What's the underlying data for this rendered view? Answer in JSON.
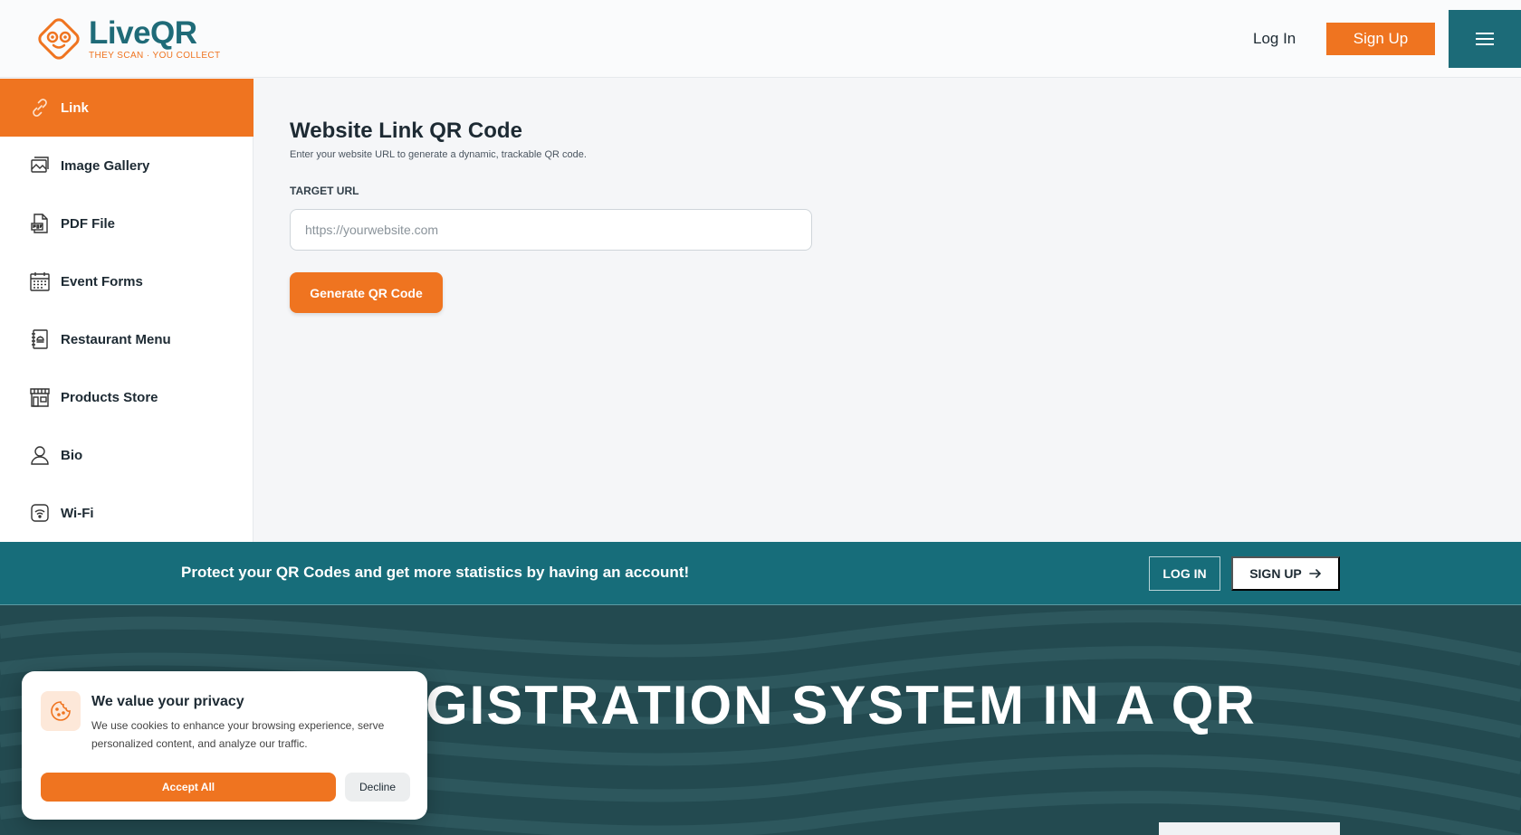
{
  "brand": {
    "name_part1": "Live",
    "name_part2": "QR",
    "tagline": "THEY SCAN · YOU COLLECT",
    "accent": "#ef7420",
    "primary": "#1c6b78"
  },
  "header": {
    "login_label": "Log In",
    "signup_label": "Sign Up",
    "menu_icon": "hamburger-icon"
  },
  "sidebar": {
    "items": [
      {
        "label": "Link",
        "icon": "link-icon",
        "active": true
      },
      {
        "label": "Image Gallery",
        "icon": "image-gallery-icon",
        "active": false
      },
      {
        "label": "PDF File",
        "icon": "pdf-file-icon",
        "active": false
      },
      {
        "label": "Event Forms",
        "icon": "calendar-icon",
        "active": false
      },
      {
        "label": "Restaurant Menu",
        "icon": "menu-book-icon",
        "active": false
      },
      {
        "label": "Products Store",
        "icon": "store-icon",
        "active": false
      },
      {
        "label": "Bio",
        "icon": "person-icon",
        "active": false
      },
      {
        "label": "Wi-Fi",
        "icon": "wifi-icon",
        "active": false
      }
    ]
  },
  "main": {
    "title": "Website Link QR Code",
    "subtitle": "Enter your website URL to generate a dynamic, trackable QR code.",
    "field_label": "TARGET URL",
    "url_value": "",
    "url_placeholder": "https://yourwebsite.com",
    "generate_label": "Generate QR Code"
  },
  "promo": {
    "text": "Protect your QR Codes and get more statistics by having an account!",
    "login_label": "LOG IN",
    "signup_label": "SIGN UP"
  },
  "hero": {
    "title_visible": "GISTRATION SYSTEM IN A QR"
  },
  "cookie": {
    "title": "We value your privacy",
    "text": "We use cookies to enhance your browsing experience, serve personalized content, and analyze our traffic.",
    "accept_label": "Accept All",
    "decline_label": "Decline"
  }
}
